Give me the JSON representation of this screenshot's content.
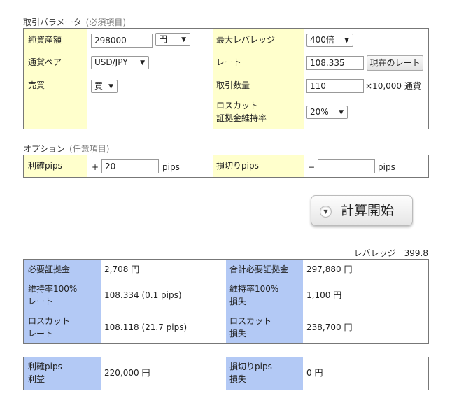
{
  "params": {
    "title": "取引パラメータ",
    "subtitle": "(必須項目)",
    "net_asset_label": "純資産額",
    "net_asset_value": "298000",
    "currency_unit": "円",
    "max_leverage_label": "最大レバレッジ",
    "max_leverage_value": "400倍",
    "pair_label": "通貨ペア",
    "pair_value": "USD/JPY",
    "rate_label": "レート",
    "rate_value": "108.335",
    "current_rate_button": "現在のレート",
    "trade_label": "売買",
    "trade_value": "買",
    "quantity_label": "取引数量",
    "quantity_value": "110",
    "quantity_unit": "×10,000 通貨",
    "losscut_label_1": "ロスカット",
    "losscut_label_2": "証拠金維持率",
    "losscut_value": "20%"
  },
  "options": {
    "title": "オプション",
    "subtitle": "(任意項目)",
    "profit_label": "利確pips",
    "profit_sign": "+",
    "profit_value": "20",
    "profit_unit": "pips",
    "loss_label": "損切りpips",
    "loss_sign": "−",
    "loss_value": "",
    "loss_unit": "pips"
  },
  "action": {
    "calc_button": "計算開始",
    "icon": "chevron-down-icon"
  },
  "results": {
    "leverage_label": "レバレッジ",
    "leverage_value": "399.8",
    "required_margin_label": "必要証拠金",
    "required_margin_value": "2,708 円",
    "total_margin_label": "合計必要証拠金",
    "total_margin_value": "297,880 円",
    "rate100_label_1": "維持率100%",
    "rate100_label_2": "レート",
    "rate100_value": "108.334 (0.1 pips)",
    "loss100_label_1": "維持率100%",
    "loss100_label_2": "損失",
    "loss100_value": "1,100 円",
    "losscut_rate_label_1": "ロスカット",
    "losscut_rate_label_2": "レート",
    "losscut_rate_value": "108.118 (21.7 pips)",
    "losscut_loss_label_1": "ロスカット",
    "losscut_loss_label_2": "損失",
    "losscut_loss_value": "238,700 円"
  },
  "pips_results": {
    "profit_label_1": "利確pips",
    "profit_label_2": "利益",
    "profit_value": "220,000 円",
    "loss_label_1": "損切りpips",
    "loss_label_2": "損失",
    "loss_value": "0 円"
  }
}
